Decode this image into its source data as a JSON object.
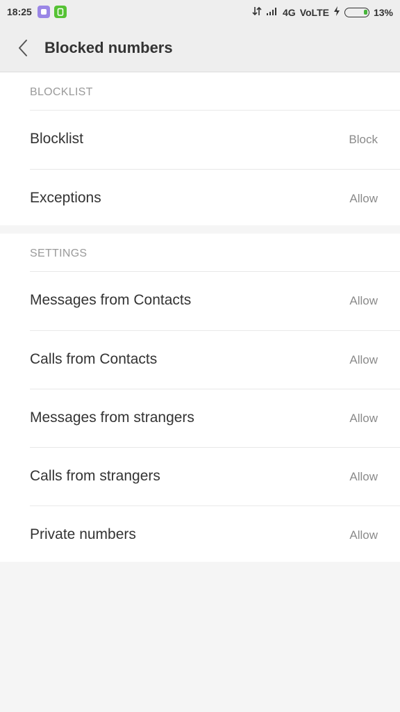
{
  "status_bar": {
    "time": "18:25",
    "network": "4G",
    "volte": "VoLTE",
    "battery": "13%",
    "battery_level": 0.13,
    "icons": [
      "notification-app-icon",
      "battery-saver-icon",
      "data-arrows-icon",
      "signal-icon",
      "charging-icon",
      "battery-icon"
    ]
  },
  "header": {
    "title": "Blocked numbers",
    "back_icon": "chevron-left-icon"
  },
  "sections": [
    {
      "title": "BLOCKLIST",
      "items": [
        {
          "label": "Blocklist",
          "value": "Block"
        },
        {
          "label": "Exceptions",
          "value": "Allow"
        }
      ]
    },
    {
      "title": "SETTINGS",
      "items": [
        {
          "label": "Messages from Contacts",
          "value": "Allow"
        },
        {
          "label": "Calls from Contacts",
          "value": "Allow"
        },
        {
          "label": "Messages from strangers",
          "value": "Allow"
        },
        {
          "label": "Calls from strangers",
          "value": "Allow"
        },
        {
          "label": "Private numbers",
          "value": "Allow"
        }
      ]
    }
  ]
}
